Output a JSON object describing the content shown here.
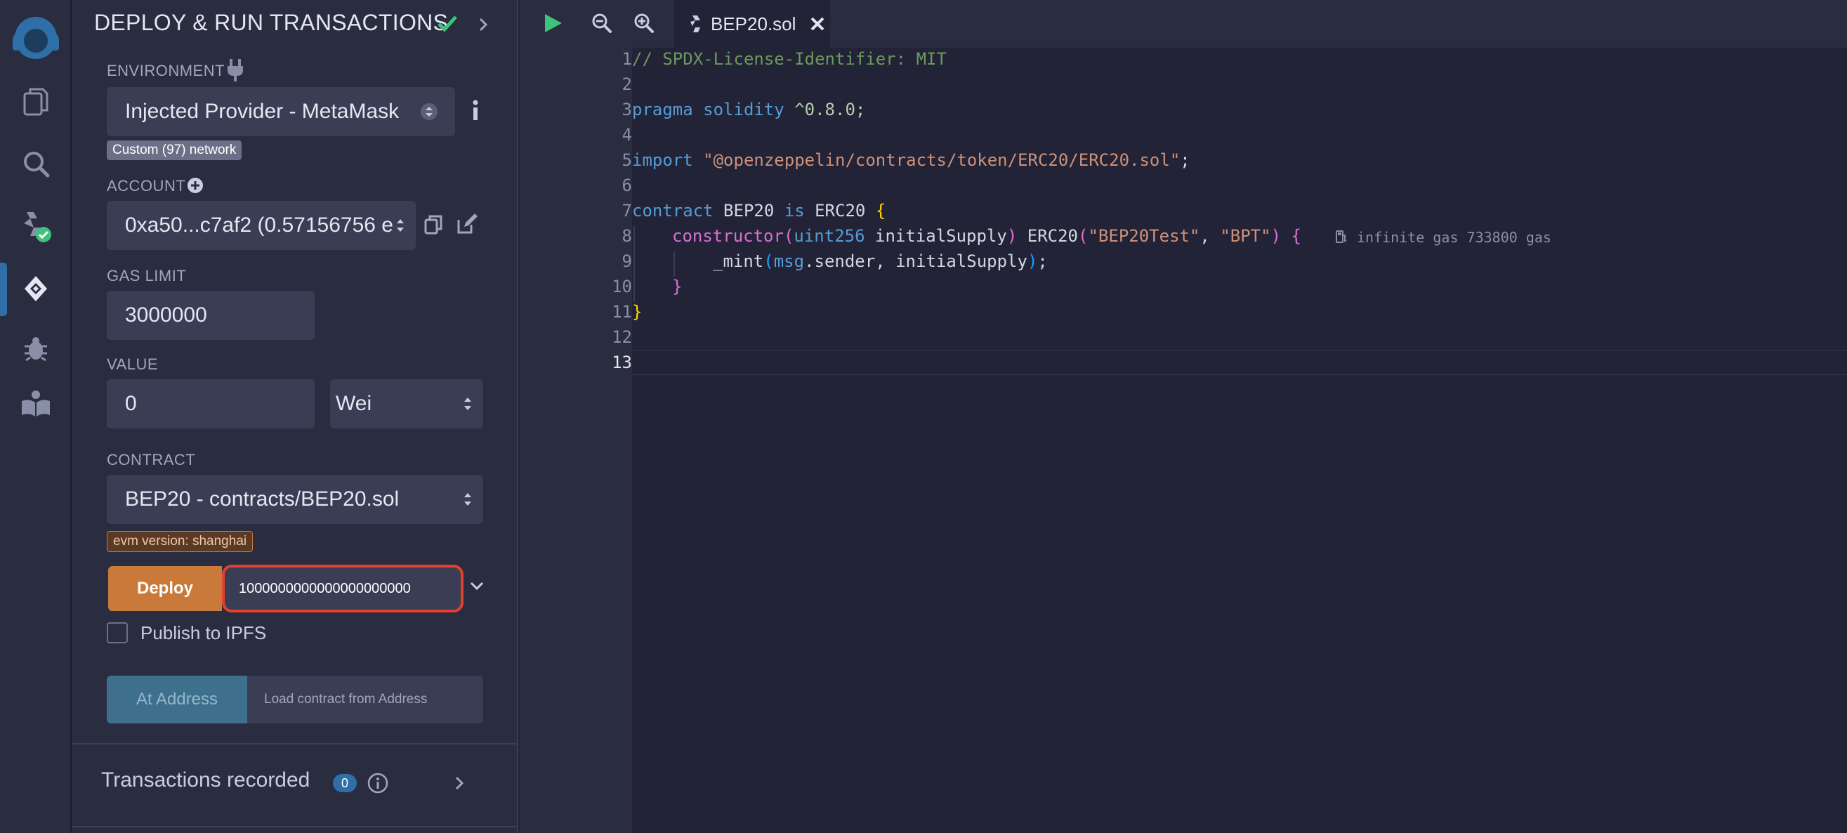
{
  "panel": {
    "title": "DEPLOY & RUN TRANSACTIONS",
    "environment": {
      "label": "ENVIRONMENT",
      "value": "Injected Provider - MetaMask",
      "network_badge": "Custom (97) network"
    },
    "account": {
      "label": "ACCOUNT",
      "value": "0xa50...c7af2 (0.57156756 e"
    },
    "gas_limit": {
      "label": "GAS LIMIT",
      "value": "3000000"
    },
    "value": {
      "label": "VALUE",
      "amount": "0",
      "unit": "Wei"
    },
    "contract": {
      "label": "CONTRACT",
      "value": "BEP20 - contracts/BEP20.sol",
      "evm_badge": "evm version: shanghai"
    },
    "deploy": {
      "button_label": "Deploy",
      "constructor_arg": "1000000000000000000000"
    },
    "publish_ipfs": {
      "label": "Publish to IPFS",
      "checked": false
    },
    "at_address": {
      "button_label": "At Address",
      "placeholder": "Load contract from Address"
    },
    "transactions": {
      "label": "Transactions recorded",
      "count": "0"
    }
  },
  "editor": {
    "tab": {
      "filename": "BEP20.sol"
    },
    "active_line": "13",
    "line_numbers": [
      "1",
      "2",
      "3",
      "4",
      "5",
      "6",
      "7",
      "8",
      "9",
      "10",
      "11",
      "12",
      "13"
    ],
    "code": {
      "l1": "// SPDX-License-Identifier: MIT",
      "l3_kw": "pragma solidity",
      "l3_ver": "^0.8.0;",
      "l5_kw": "import",
      "l5_path": "\"@openzeppelin/contracts/token/ERC20/ERC20.sol\"",
      "l5_end": ";",
      "l7_kw1": "contract",
      "l7_name": " BEP20 ",
      "l7_kw2": "is",
      "l7_base": " ERC20 ",
      "l7_brace": "{",
      "l8_ctor": "constructor",
      "l8_p1": "(",
      "l8_type": "uint256",
      "l8_arg": " initialSupply",
      "l8_p2": ")",
      "l8_call": " ERC20",
      "l8_p3": "(",
      "l8_s1": "\"BEP20Test\"",
      "l8_comma": ", ",
      "l8_s2": "\"BPT\"",
      "l8_p4": ")",
      "l8_brace": " {",
      "l9_fn": "_mint",
      "l9_p1": "(",
      "l9_msg": "msg",
      "l9_rest": ".sender, initialSupply",
      "l9_p2": ")",
      "l9_end": ";",
      "l10": "}",
      "l11": "}"
    },
    "gas_hint": "infinite gas 733800 gas"
  },
  "colors": {
    "accent_blue": "#2f6fa7",
    "deploy_orange": "#c97a3a",
    "success_green": "#3ec47a",
    "focus_red": "#e2412d"
  },
  "icons": {
    "rail": [
      "remix-logo-icon",
      "file-explorer-icon",
      "search-icon",
      "solidity-compiler-icon",
      "deploy-run-icon",
      "debugger-icon",
      "learneth-icon"
    ]
  }
}
